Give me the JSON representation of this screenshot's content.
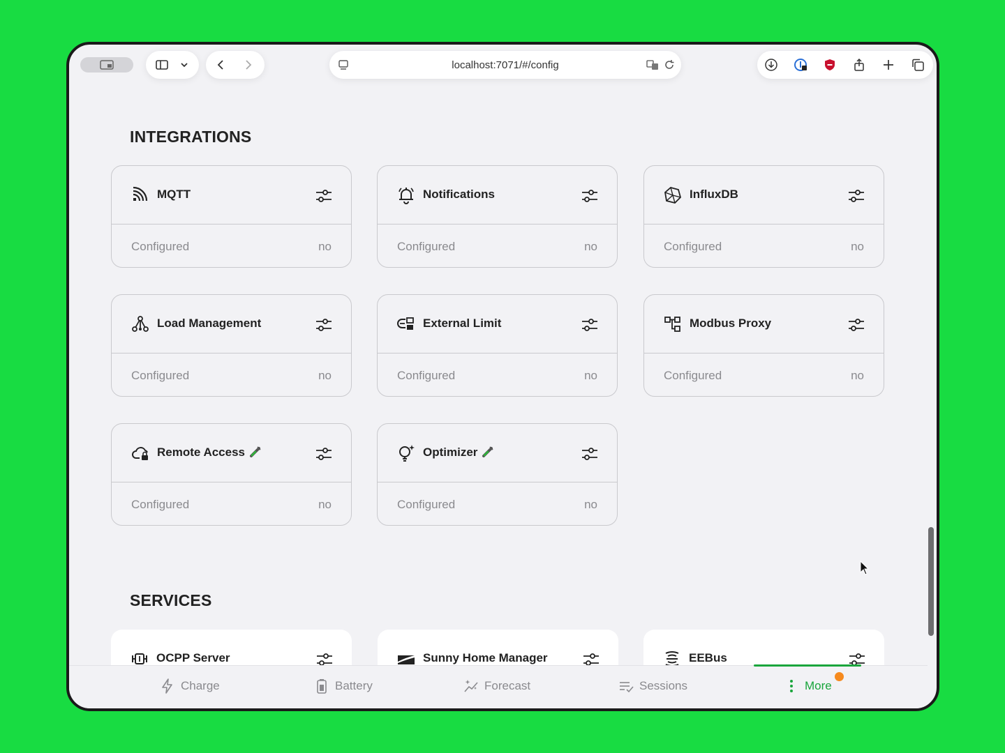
{
  "browser": {
    "url": "localhost:7071/#/config"
  },
  "integrations": {
    "title": "INTEGRATIONS",
    "cards": [
      {
        "title": "MQTT",
        "label": "Configured",
        "value": "no",
        "icon": "mqtt-icon"
      },
      {
        "title": "Notifications",
        "label": "Configured",
        "value": "no",
        "icon": "bell-icon"
      },
      {
        "title": "InfluxDB",
        "label": "Configured",
        "value": "no",
        "icon": "influxdb-icon"
      },
      {
        "title": "Load Management",
        "label": "Configured",
        "value": "no",
        "icon": "load-management-icon"
      },
      {
        "title": "External Limit",
        "label": "Configured",
        "value": "no",
        "icon": "external-limit-icon"
      },
      {
        "title": "Modbus Proxy",
        "label": "Configured",
        "value": "no",
        "icon": "modbus-proxy-icon"
      },
      {
        "title": "Remote Access",
        "label": "Configured",
        "value": "no",
        "icon": "cloud-lock-icon",
        "experimental": true
      },
      {
        "title": "Optimizer",
        "label": "Configured",
        "value": "no",
        "icon": "lightbulb-icon",
        "experimental": true
      }
    ]
  },
  "services": {
    "title": "SERVICES",
    "cards": [
      {
        "title": "OCPP Server",
        "icon": "ocpp-icon"
      },
      {
        "title": "Sunny Home Manager",
        "icon": "sunny-home-manager-icon"
      },
      {
        "title": "EEBus",
        "icon": "eebus-icon"
      }
    ]
  },
  "nav": {
    "items": [
      {
        "label": "Charge",
        "icon": "lightning-icon"
      },
      {
        "label": "Battery",
        "icon": "battery-icon"
      },
      {
        "label": "Forecast",
        "icon": "forecast-icon"
      },
      {
        "label": "Sessions",
        "icon": "sessions-icon"
      },
      {
        "label": "More",
        "icon": "more-icon",
        "active": true
      }
    ]
  },
  "colors": {
    "background": "#18dc42",
    "accent": "#1aa53c",
    "badge": "#f68a1e",
    "card_border": "#c9c9cd",
    "muted_text": "#8a8a8e"
  }
}
